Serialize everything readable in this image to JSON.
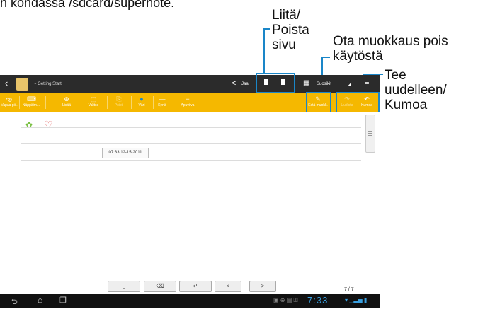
{
  "top_caption": "n kondassa /sdcard/supernote.",
  "callouts": {
    "insert_delete": [
      "Liitä/",
      "Poista",
      "sivu"
    ],
    "edit_off": [
      "Ota muokkaus pois",
      "käytöstä"
    ],
    "redo_undo": [
      "Tee",
      "uudelleen/",
      "Kumoa"
    ]
  },
  "actionbar": {
    "back_glyph": "‹",
    "title": "~ Getting Start",
    "share_label": "Jaa",
    "favorites_label": "Suosikit"
  },
  "toolbar": {
    "items": [
      {
        "label": "Vapaa pii..",
        "icon": "ఌ"
      },
      {
        "label": "Näppäim...",
        "icon": "⌨"
      },
      {
        "label": "Lisää",
        "icon": "⊕"
      },
      {
        "label": "Valitse",
        "icon": "⬚"
      },
      {
        "label": "Poist.",
        "icon": "⎘"
      },
      {
        "label": "Väri",
        "icon": "●"
      },
      {
        "label": "Kynä",
        "icon": "—"
      },
      {
        "label": "Apuviiva",
        "icon": "≡"
      }
    ],
    "edit_off_label": "Estä muokk.",
    "redo_label": "Uudista",
    "undo_label": "Kumoa"
  },
  "note": {
    "timestamp": "07:33 12-15-2011",
    "page_counter": "7  /  7"
  },
  "keys": [
    "⎵",
    "⌫",
    "↵",
    "<",
    ">"
  ],
  "navbar": {
    "back": "⮌",
    "home": "⌂",
    "recent": "❐",
    "clock": "7:33"
  },
  "colors": {
    "accent": "#1a86c8",
    "toolbar": "#f5b800",
    "actionbar": "#2b2b2b"
  }
}
